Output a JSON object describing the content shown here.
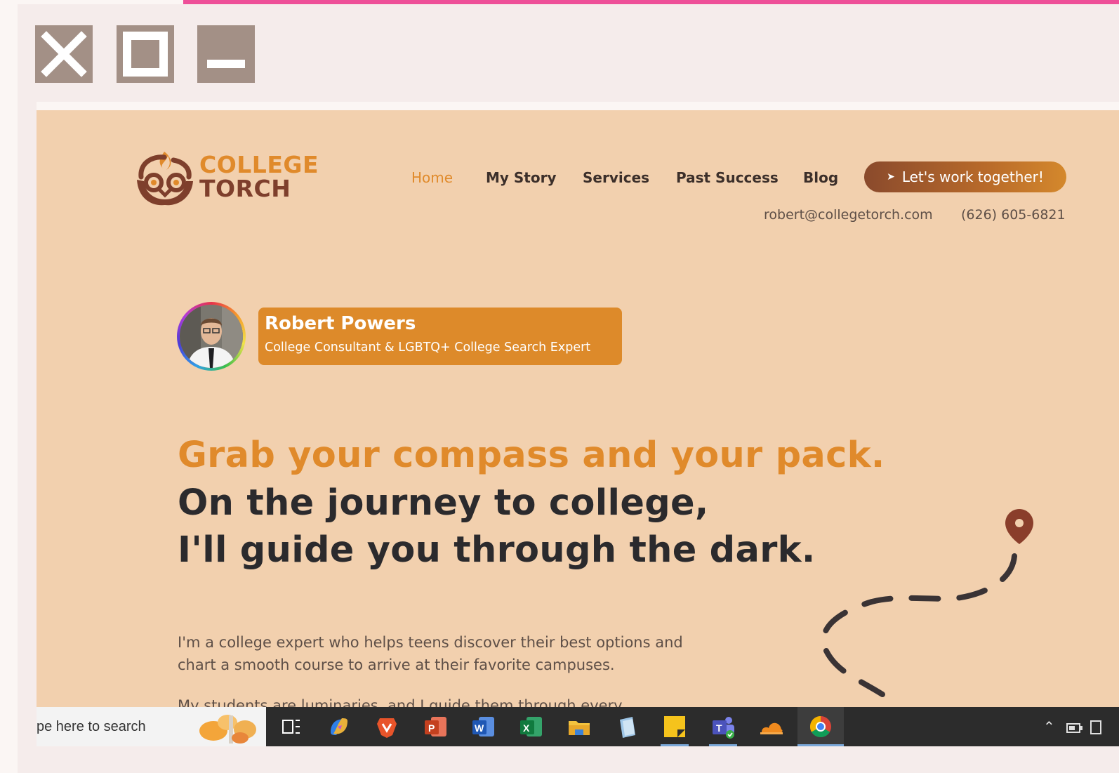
{
  "window": {
    "close_icon": "close-icon",
    "maximize_icon": "maximize-icon",
    "minimize_icon": "minimize-icon"
  },
  "site": {
    "logo": {
      "line1": "COLLEGE",
      "line2": "TORCH",
      "icon": "owl-torch-logo"
    },
    "nav": {
      "home": "Home",
      "my_story": "My Story",
      "services": "Services",
      "past_success": "Past Success",
      "blog": "Blog"
    },
    "cta": {
      "label": "Let's work together!",
      "icon": "cursor-icon"
    },
    "contact": {
      "email": "robert@collegetorch.com",
      "phone": "(626) 605-6821"
    },
    "profile": {
      "name": "Robert Powers",
      "title": "College Consultant &  LGBTQ+ College Search Expert"
    },
    "hero": {
      "line1": "Grab your compass and your pack.",
      "line2": "On the journey to college,",
      "line3": "I'll guide you through the dark."
    },
    "body": {
      "paragraph": "I'm a college expert who helps teens discover their best options and chart a smooth course to arrive at their favorite campuses.",
      "cut_line": "My students are luminaries, and I guide them through every"
    },
    "colors": {
      "background": "#f2d0ae",
      "accent_orange": "#e08a2b",
      "brand_brown": "#7e3f2c",
      "text_dark": "#2b2a2d"
    }
  },
  "taskbar": {
    "search_text": "pe here to search",
    "apps": [
      "task-view-icon",
      "copilot-icon",
      "brave-icon",
      "powerpoint-icon",
      "word-icon",
      "excel-icon",
      "file-explorer-icon",
      "notepad-icon",
      "sticky-notes-icon",
      "teams-icon",
      "cloud-app-icon",
      "chrome-icon"
    ],
    "tray": [
      "chevron-up-icon",
      "network-icon"
    ]
  }
}
